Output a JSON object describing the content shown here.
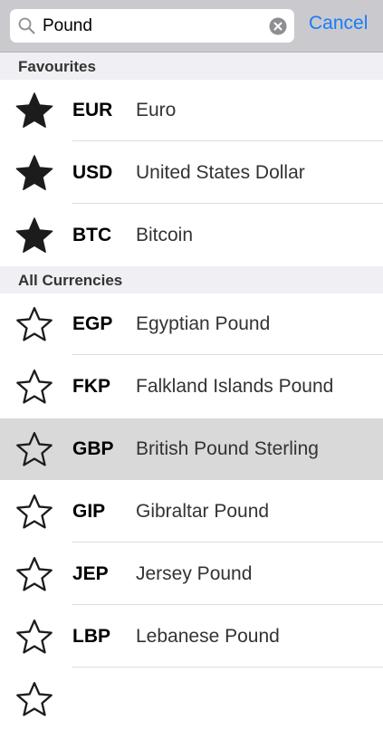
{
  "search": {
    "query": "Pound",
    "cancel_label": "Cancel",
    "search_icon": "magnifier-icon",
    "clear_icon": "clear-circle-icon"
  },
  "favourites": {
    "header": "Favourites",
    "items": [
      {
        "code": "EUR",
        "name": "Euro",
        "starred": true
      },
      {
        "code": "USD",
        "name": "United States Dollar",
        "starred": true
      },
      {
        "code": "BTC",
        "name": "Bitcoin",
        "starred": true
      }
    ]
  },
  "all_currencies": {
    "header": "All Currencies",
    "items": [
      {
        "code": "EGP",
        "name": "Egyptian Pound",
        "starred": false
      },
      {
        "code": "FKP",
        "name": "Falkland Islands Pound",
        "starred": false
      },
      {
        "code": "GBP",
        "name": "British Pound Sterling",
        "starred": false,
        "selected": true
      },
      {
        "code": "GIP",
        "name": "Gibraltar Pound",
        "starred": false
      },
      {
        "code": "JEP",
        "name": "Jersey Pound",
        "starred": false
      },
      {
        "code": "LBP",
        "name": "Lebanese Pound",
        "starred": false
      }
    ]
  },
  "colors": {
    "accent": "#1a7cf5",
    "selected_row": "#d9d9d9",
    "section_header_bg": "#efeff4"
  }
}
